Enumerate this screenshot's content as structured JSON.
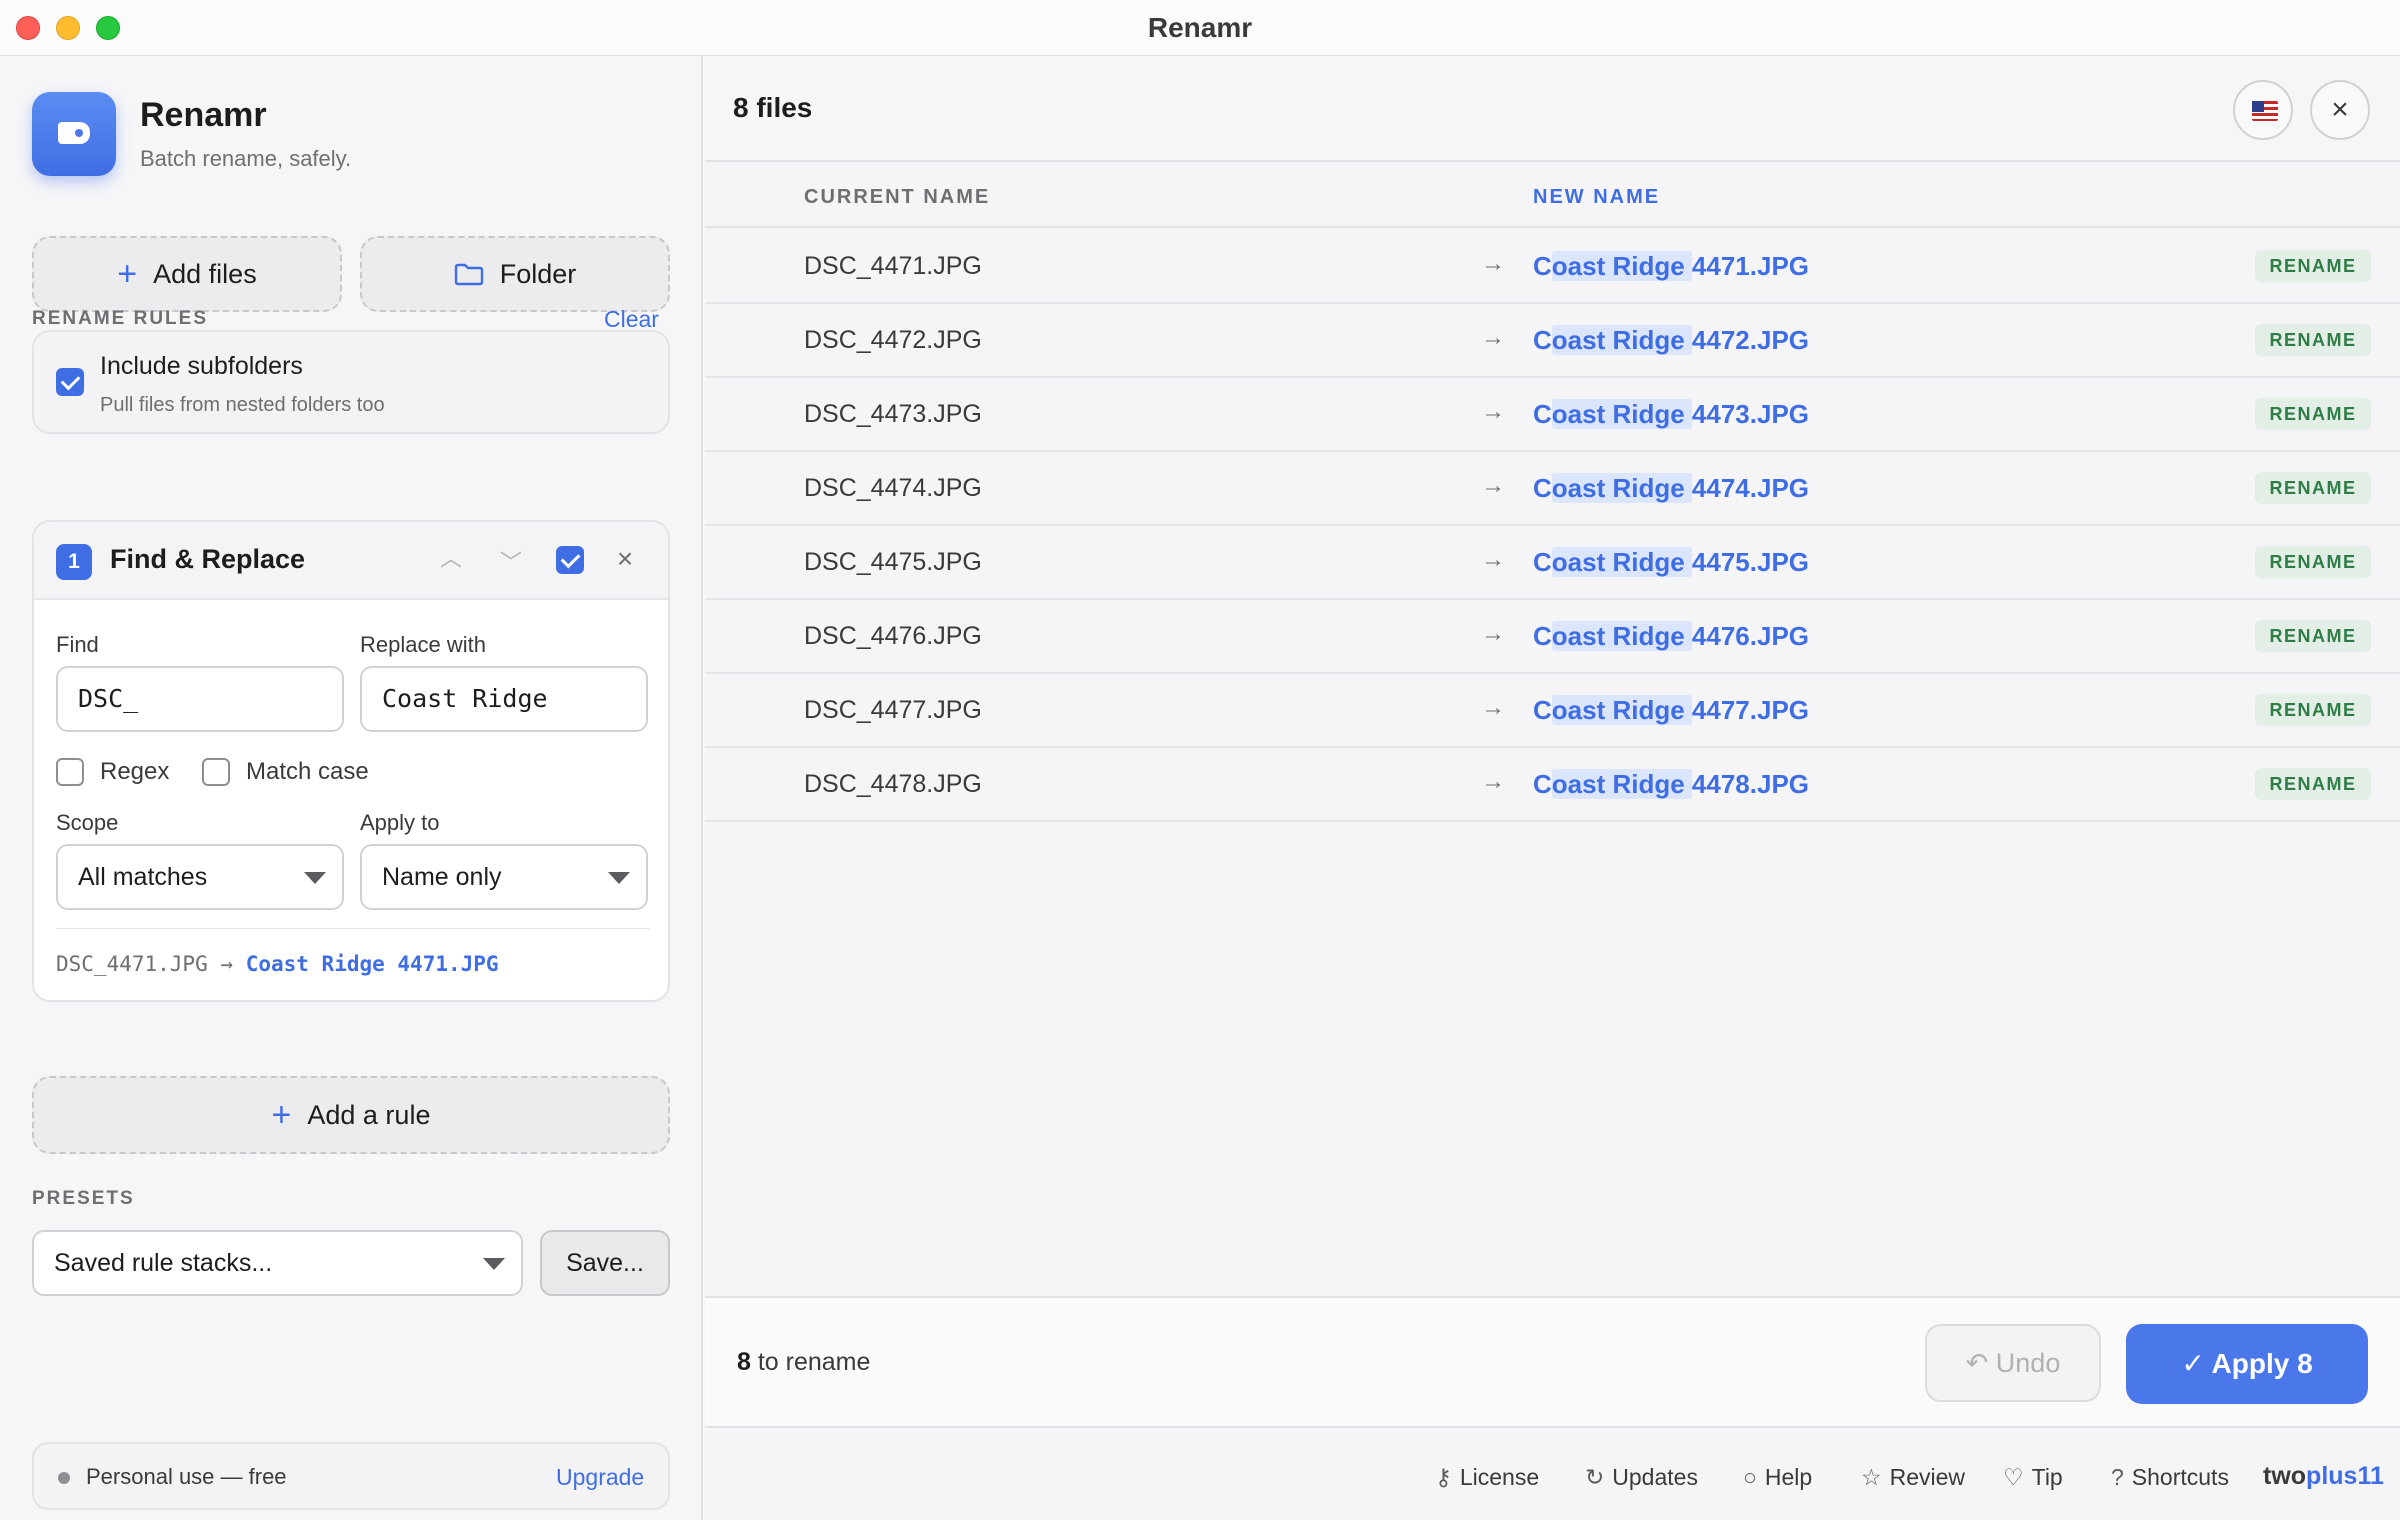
{
  "window": {
    "title": "Renamr"
  },
  "sidebar": {
    "app_name": "Renamr",
    "app_tagline": "Batch rename, safely.",
    "add_files_label": "Add files",
    "folder_label": "Folder",
    "subfolders": {
      "title": "Include subfolders",
      "desc": "Pull files from nested folders too",
      "checked": true
    },
    "rules_label": "RENAME RULES",
    "clear_label": "Clear",
    "rule": {
      "number": "1",
      "title": "Find & Replace",
      "enabled": true,
      "find_label": "Find",
      "find_value": "DSC_",
      "replace_label": "Replace with",
      "replace_value": "Coast Ridge",
      "regex_label": "Regex",
      "match_case_label": "Match case",
      "scope_label": "Scope",
      "scope_value": "All matches",
      "apply_to_label": "Apply to",
      "apply_to_value": "Name only",
      "preview_old": "DSC_4471.JPG",
      "preview_arrow": "→",
      "preview_new": "Coast Ridge 4471.JPG"
    },
    "add_rule_label": "Add a rule",
    "presets_label": "PRESETS",
    "preset_value": "Saved rule stacks...",
    "save_label": "Save...",
    "license_text": "Personal use — free",
    "upgrade_label": "Upgrade"
  },
  "main": {
    "file_count": "8 files",
    "col_current": "CURRENT NAME",
    "col_new": "NEW NAME",
    "rows": [
      {
        "current": "DSC_4471.JPG",
        "new_c": "C",
        "new_hl": "oast Ridge ",
        "new_rest": "4471.JPG",
        "badge": "RENAME"
      },
      {
        "current": "DSC_4472.JPG",
        "new_c": "C",
        "new_hl": "oast Ridge ",
        "new_rest": "4472.JPG",
        "badge": "RENAME"
      },
      {
        "current": "DSC_4473.JPG",
        "new_c": "C",
        "new_hl": "oast Ridge ",
        "new_rest": "4473.JPG",
        "badge": "RENAME"
      },
      {
        "current": "DSC_4474.JPG",
        "new_c": "C",
        "new_hl": "oast Ridge ",
        "new_rest": "4474.JPG",
        "badge": "RENAME"
      },
      {
        "current": "DSC_4475.JPG",
        "new_c": "C",
        "new_hl": "oast Ridge ",
        "new_rest": "4475.JPG",
        "badge": "RENAME"
      },
      {
        "current": "DSC_4476.JPG",
        "new_c": "C",
        "new_hl": "oast Ridge ",
        "new_rest": "4476.JPG",
        "badge": "RENAME"
      },
      {
        "current": "DSC_4477.JPG",
        "new_c": "C",
        "new_hl": "oast Ridge ",
        "new_rest": "4477.JPG",
        "badge": "RENAME"
      },
      {
        "current": "DSC_4478.JPG",
        "new_c": "C",
        "new_hl": "oast Ridge ",
        "new_rest": "4478.JPG",
        "badge": "RENAME"
      }
    ],
    "rename_count": "8",
    "rename_suffix": " to rename",
    "undo_label": "Undo",
    "apply_label": "Apply 8"
  },
  "footer": {
    "license": "License",
    "updates": "Updates",
    "help": "Help",
    "review": "Review",
    "tip": "Tip",
    "shortcuts": "Shortcuts",
    "brand_a": "two",
    "brand_b": "plus11"
  },
  "colors": {
    "accent": "#3f6ee4",
    "badge_bg": "#e3efe6",
    "badge_fg": "#2e7d46"
  }
}
